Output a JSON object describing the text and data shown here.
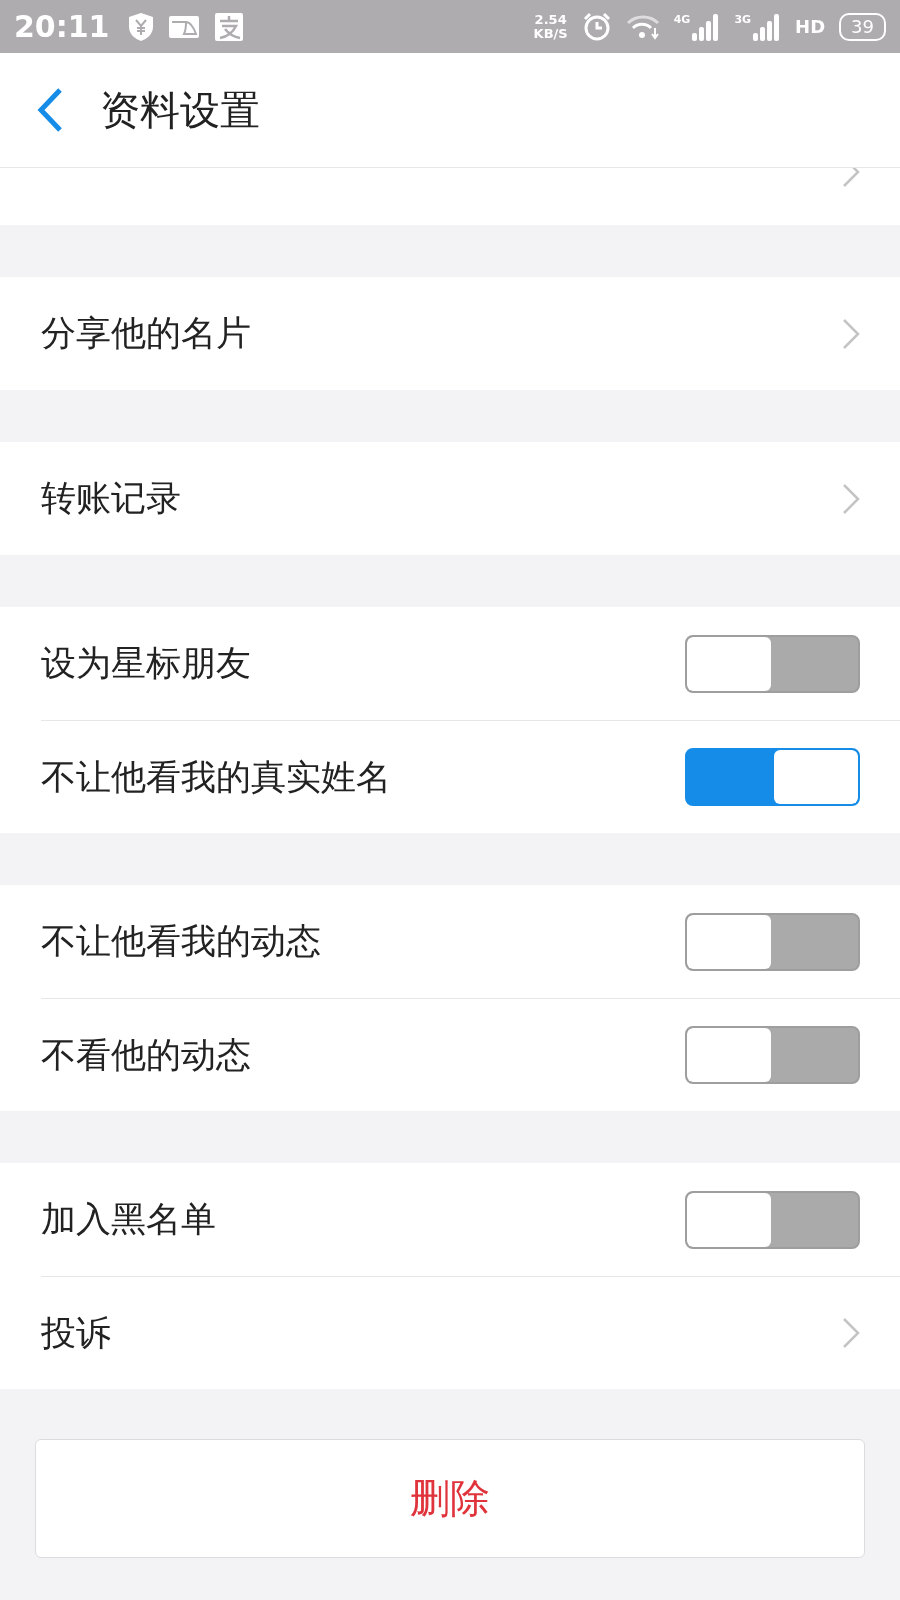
{
  "status_bar": {
    "time": "20:11",
    "speed_value": "2.54",
    "speed_unit": "KB/S",
    "network_1": "4G",
    "network_2": "3G",
    "hd": "HD",
    "battery": "39"
  },
  "header": {
    "title": "资料设置"
  },
  "groups": [
    {
      "items": [
        {
          "kind": "link",
          "label": "分享他的名片"
        }
      ]
    },
    {
      "items": [
        {
          "kind": "link",
          "label": "转账记录"
        }
      ]
    },
    {
      "items": [
        {
          "kind": "switch",
          "label": "设为星标朋友",
          "on": false
        },
        {
          "kind": "switch",
          "label": "不让他看我的真实姓名",
          "on": true
        }
      ]
    },
    {
      "items": [
        {
          "kind": "switch",
          "label": "不让他看我的动态",
          "on": false
        },
        {
          "kind": "switch",
          "label": "不看他的动态",
          "on": false
        }
      ]
    },
    {
      "items": [
        {
          "kind": "switch",
          "label": "加入黑名单",
          "on": false
        },
        {
          "kind": "link",
          "label": "投诉"
        }
      ]
    }
  ],
  "delete_button": "删除"
}
